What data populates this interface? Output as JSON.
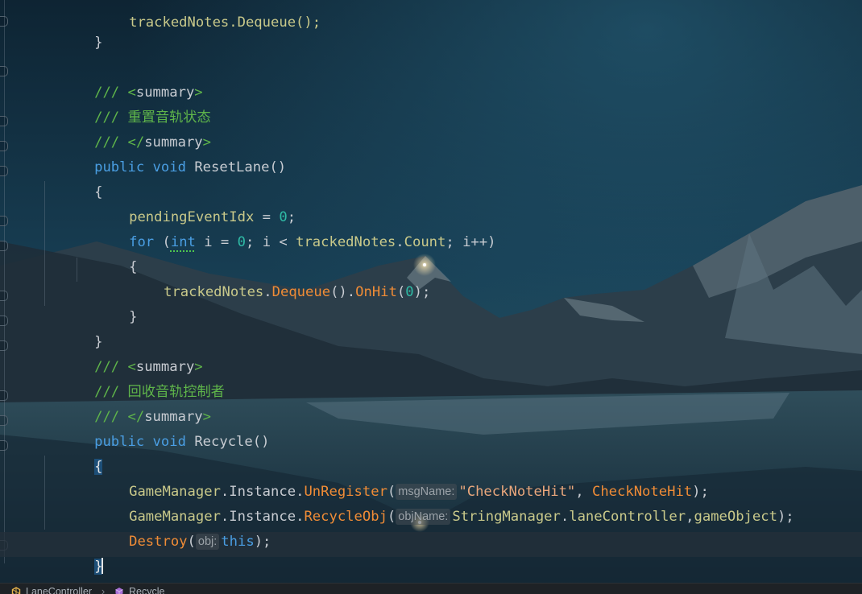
{
  "colors": {
    "keyword": "#4a9ee3",
    "comment": "#5fb54a",
    "method": "#f08c36",
    "field": "#c9c98a",
    "number": "#2fbba6",
    "string": "#e9a77c",
    "plain": "#c8ccd2",
    "brace_highlight": "#1d4f78"
  },
  "code": {
    "line_01": "trackedNotes.Dequeue();",
    "line_02_brace": "}",
    "line_04": {
      "slashes": "///",
      "open": "<",
      "tag": "summary",
      "close": ">"
    },
    "line_05": {
      "slashes": "///",
      "text": "重置音轨状态"
    },
    "line_06": {
      "slashes": "///",
      "open": "</",
      "tag": "summary",
      "close": ">"
    },
    "line_07": {
      "kw1": "public",
      "kw2": "void",
      "name": "ResetLane",
      "parens": "()"
    },
    "line_08": "{",
    "line_09": {
      "field": "pendingEventIdx",
      "op": " = ",
      "num": "0",
      "semi": ";"
    },
    "line_10": {
      "kw": "for",
      "open": " (",
      "type": "int",
      "var": " i = ",
      "num": "0",
      "mid": "; i < ",
      "obj": "trackedNotes",
      "dot": ".",
      "prop": "Count",
      "end": "; i++)"
    },
    "line_11": "{",
    "line_12": {
      "obj": "trackedNotes",
      "dot1": ".",
      "m1": "Dequeue",
      "p1": "()",
      "dot2": ".",
      "m2": "OnHit",
      "open": "(",
      "num": "0",
      "end": ");"
    },
    "line_13": "}",
    "line_14": "}",
    "line_15": {
      "slashes": "///",
      "open": "<",
      "tag": "summary",
      "close": ">"
    },
    "line_16": {
      "slashes": "///",
      "text": "回收音轨控制者"
    },
    "line_17": {
      "slashes": "///",
      "open": "</",
      "tag": "summary",
      "close": ">"
    },
    "line_18": {
      "kw1": "public",
      "kw2": "void",
      "name": "Recycle",
      "parens": "()"
    },
    "line_19": "{",
    "line_20": {
      "cls": "GameManager",
      "dot1": ".",
      "prop": "Instance",
      "dot2": ".",
      "method": "UnRegister",
      "open": "(",
      "hint": "msgName:",
      "str": "\"CheckNoteHit\"",
      "comma": ", ",
      "arg": "CheckNoteHit",
      "end": ");"
    },
    "line_21": {
      "cls": "GameManager",
      "dot1": ".",
      "prop": "Instance",
      "dot2": ".",
      "method": "RecycleObj",
      "open": "(",
      "hint": "objName:",
      "cls2": "StringManager",
      "dot3": ".",
      "field": "laneController",
      "comma": ",",
      "arg": "gameObject",
      "end": ");"
    },
    "line_22": {
      "method": "Destroy",
      "open": "(",
      "hint": "obj:",
      "kw": "this",
      "end": ");"
    },
    "line_23": "}",
    "line_24": "}"
  },
  "breadcrumb": {
    "class_icon": "unity-class-icon",
    "class_name": "LaneController",
    "separator": "›",
    "method_icon": "method-cube-icon",
    "method_name": "Recycle"
  }
}
